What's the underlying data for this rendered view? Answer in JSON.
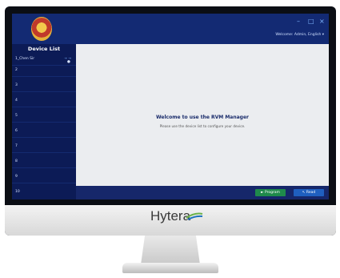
{
  "titlebar": {
    "minimize": "–",
    "restore": "□",
    "close": "×",
    "user_info": "Welcome: Admin, English"
  },
  "sidebar": {
    "title": "Device List",
    "items": [
      {
        "label": "1_Chen Sir"
      },
      {
        "label": "2"
      },
      {
        "label": "3"
      },
      {
        "label": "4"
      },
      {
        "label": "5"
      },
      {
        "label": "6"
      },
      {
        "label": "7"
      },
      {
        "label": "8"
      },
      {
        "label": "9"
      },
      {
        "label": "10"
      }
    ],
    "item1_status": "●",
    "item1_arrow": "⇢",
    "item1_extra": "⇢"
  },
  "main": {
    "title": "Welcome to use the RVM Manager",
    "subtitle": "Please use the device list to configure your device."
  },
  "footer": {
    "program_label": "► Program",
    "read_label": "↖ Read"
  },
  "brand": {
    "name": "Hytera"
  }
}
